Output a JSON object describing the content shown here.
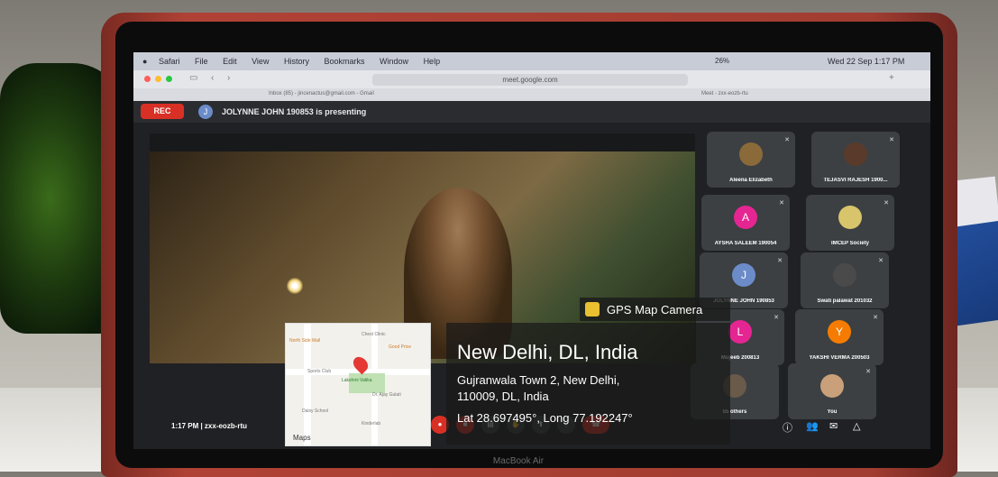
{
  "browser": {
    "app_menu": [
      "Safari",
      "File",
      "Edit",
      "View",
      "History",
      "Bookmarks",
      "Window",
      "Help"
    ],
    "status_right": "Wed 22 Sep  1:17 PM",
    "battery": "26%",
    "url": "meet.google.com",
    "tabs": [
      "Inbox (85) - jincenactus@gmail.com - Gmail",
      "Meet - zxx-eozb-rtu"
    ]
  },
  "meet": {
    "rec_label": "REC",
    "presenter_initial": "J",
    "presenting_text": "JOLYNNE JOHN 190853 is presenting",
    "time_code": "1:17 PM  |  zxx-eozb-rtu",
    "participants": [
      {
        "name": "Aleena Elizabeth",
        "initial": "",
        "color": "#8b6a3a"
      },
      {
        "name": "TEJASVI RAJESH 1900...",
        "initial": "",
        "color": "#5a3a2a"
      },
      {
        "name": "AYSHA SALEEM 190054",
        "initial": "A",
        "color": "#e52592"
      },
      {
        "name": "IMCEP Society",
        "initial": "",
        "color": "#d8c46a"
      },
      {
        "name": "JOLYNNE JOHN 190853",
        "initial": "J",
        "color": "#6b8cc9"
      },
      {
        "name": "Swati palawat 201032",
        "initial": "",
        "color": "#4a4a4a"
      },
      {
        "name": "Mujeeb 200813",
        "initial": "L",
        "color": "#e52592"
      },
      {
        "name": "YAKSHI VERMA 200503",
        "initial": "Y",
        "color": "#f57c00"
      },
      {
        "name": "55 others",
        "initial": "",
        "color": "#6a5a4a"
      },
      {
        "name": "You",
        "initial": "",
        "color": "#c9a07a"
      }
    ]
  },
  "gps_overlay": {
    "badge": "GPS Map Camera",
    "city": "New Delhi, DL, India",
    "address_line1": "Gujranwala Town 2, New Delhi,",
    "address_line2": "110009, DL, India",
    "coords": "Lat 28.697495°, Long 77.192247°",
    "map_labels": [
      "North Side Mall",
      "Chest Clinic",
      "Good Price",
      "Sports Club",
      "Lakshmi Vatika",
      "Dr. Ajay Gulati",
      "Daisy School",
      "Kinderlab"
    ],
    "map_footer": "Maps"
  },
  "laptop_label": "MacBook Air"
}
